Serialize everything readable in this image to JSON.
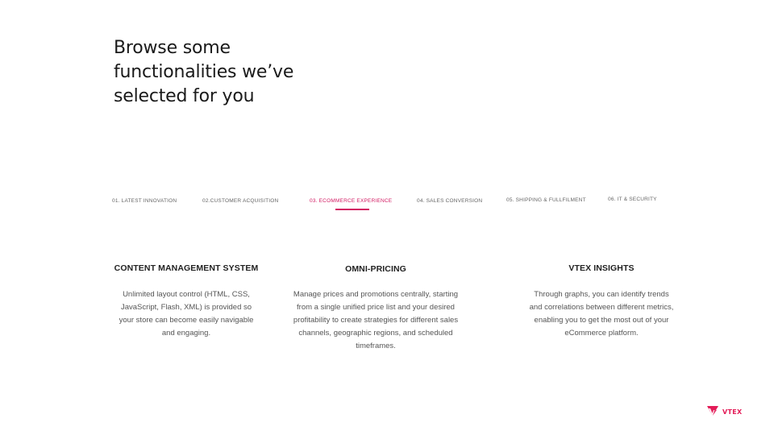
{
  "headline": {
    "line1": "Browse some",
    "line2": "functionalities we’ve",
    "line3": "selected for you"
  },
  "tabs": [
    {
      "label": "01. LATEST INNOVATION",
      "active": false
    },
    {
      "label": "02.CUSTOMER ACQUISITION",
      "active": false
    },
    {
      "label": "03. ECOMMERCE EXPERIENCE",
      "active": true
    },
    {
      "label": "04. SALES CONVERSION",
      "active": false
    },
    {
      "label": "05. SHIPPING & FULLFILMENT",
      "active": false
    },
    {
      "label": "06. IT & SECURITY",
      "active": false
    }
  ],
  "cards": [
    {
      "title": "CONTENT MANAGEMENT SYSTEM",
      "description": "Unlimited layout control (HTML, CSS, JavaScript, Flash, XML) is provided so your store can become easily navigable and engaging."
    },
    {
      "title": "OMNI-PRICING",
      "description": "Manage prices and promotions centrally, starting from a single unified price list and your desired profitability to create strategies for different sales channels, geographic regions, and scheduled timeframes."
    },
    {
      "title": "VTEX INSIGHTS",
      "description": "Through graphs, you can identify trends and correlations between different metrics, enabling you to get the most out of your eCommerce platform."
    }
  ],
  "logo": {
    "icon": "vtex-logo-icon",
    "text": "VTEX"
  },
  "colors": {
    "accent": "#d21a62",
    "logo": "#e31c58",
    "background": "#ffffff"
  }
}
